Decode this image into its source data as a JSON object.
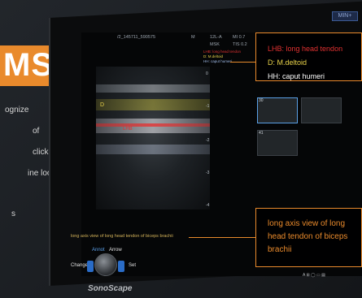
{
  "badge": {
    "text": "MSK"
  },
  "left_copy": [
    "ognize",
    "of",
    "click,",
    "ine loop",
    "s"
  ],
  "header": {
    "left_id": "/2_145711_590575",
    "mode": "M",
    "probe": "12L-A",
    "mi": "MI 0.7",
    "preset": "MSK",
    "tis": "TIS 0.2",
    "top_right": "MIN+"
  },
  "overlay_labels": {
    "lhb": "LHB: long head tendon",
    "d": "D: M.deltoid",
    "hh": "HH: caput humeri"
  },
  "image_markers": {
    "d": "D",
    "lhb": "LHB"
  },
  "depth_ruler": [
    "0",
    "-1",
    "-2",
    "-3",
    "-4"
  ],
  "thumbnails": [
    {
      "label": "30"
    },
    {
      "label": "41"
    }
  ],
  "callout_top": {
    "line1": "LHB: long head tendon",
    "line2": "D: M.deltoid",
    "line3": "HH: caput humeri"
  },
  "callout_bottom": {
    "text": "long axis view of long head tendon of biceps brachii"
  },
  "caption": "long axis view of long head tendon of biceps brachii",
  "controls": {
    "annot": "Annot",
    "arrow": "Arrow",
    "change": "Change",
    "set": "Set"
  },
  "brand": "SonoScape",
  "colors": {
    "accent": "#e98a2c",
    "lhb_red": "#e03131",
    "d_yellow": "#e8d24a",
    "hh_blue": "#9fb9e6"
  }
}
